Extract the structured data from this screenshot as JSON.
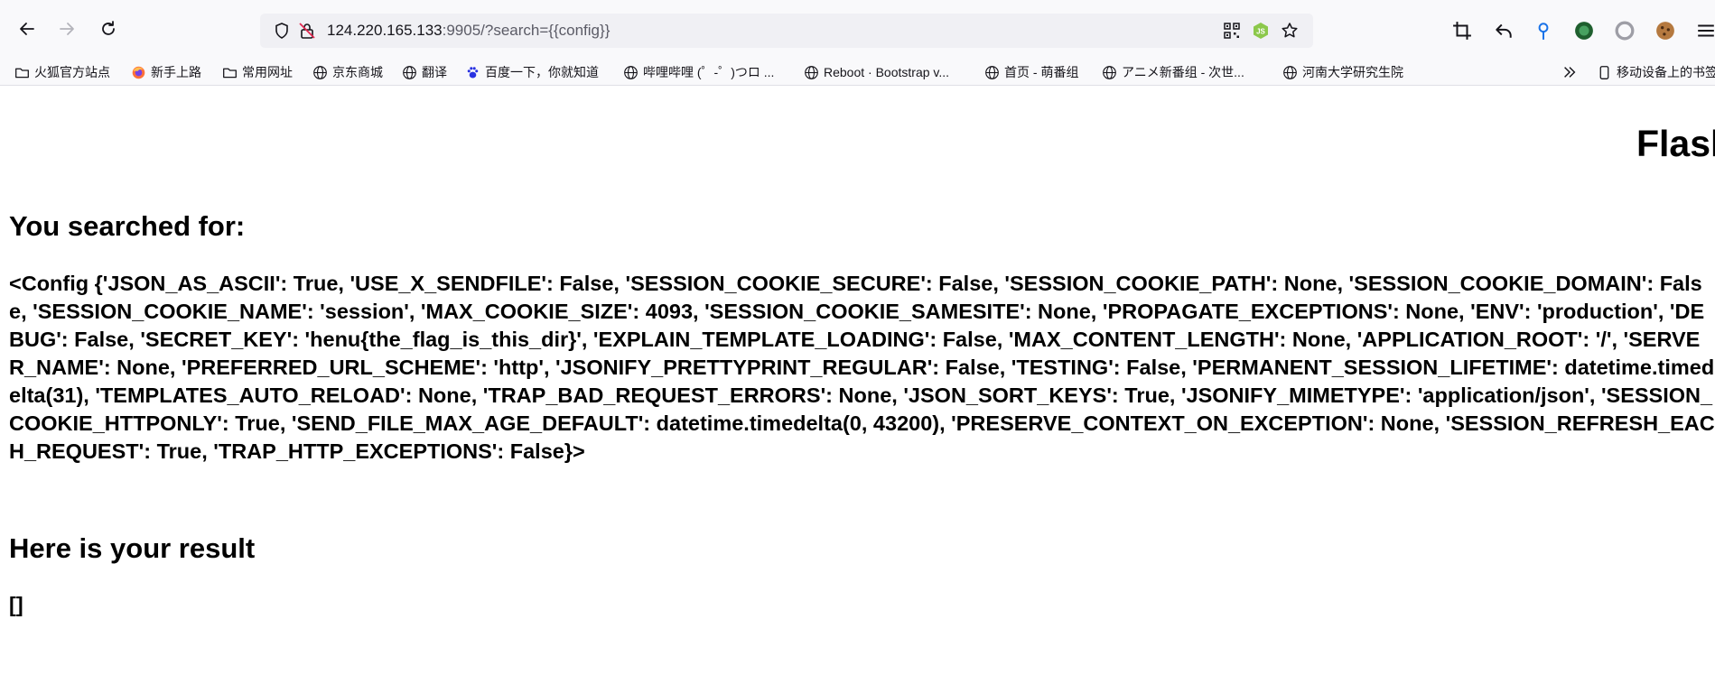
{
  "browser": {
    "url_host": "124.220.165.133",
    "url_rest": ":9905/?search={{config}}",
    "icons": {
      "back": "back-arrow-icon",
      "forward": "forward-arrow-icon",
      "reload": "reload-icon",
      "shield": "tracking-protection-shield-icon",
      "lock": "insecure-lock-icon",
      "qr": "qr-code-icon",
      "node": "nodejs-extension-icon",
      "star": "bookmark-star-icon",
      "screenshot": "crop-screenshot-icon",
      "undo": "undo-arrow-icon",
      "location": "location-pin-icon",
      "ext_green": "green-extension-icon",
      "ext_gray": "gray-circle-extension-icon",
      "cookie": "cookie-icon",
      "menu": "hamburger-menu-icon"
    }
  },
  "bookmarks": {
    "items": [
      {
        "label": "火狐官方站点",
        "icon": "folder-icon"
      },
      {
        "label": "新手上路",
        "icon": "firefox-icon"
      },
      {
        "label": "常用网址",
        "icon": "folder-icon"
      },
      {
        "label": "京东商城",
        "icon": "globe-icon"
      },
      {
        "label": "翻译",
        "icon": "globe-icon"
      },
      {
        "label": "百度一下，你就知道",
        "icon": "baidu-paw-icon"
      },
      {
        "label": "哔哩哔哩 (゜-゜)つロ ...",
        "icon": "globe-icon"
      },
      {
        "label": "Reboot · Bootstrap v...",
        "icon": "globe-icon"
      },
      {
        "label": "首页 - 萌番组",
        "icon": "globe-icon"
      },
      {
        "label": "アニメ新番组 - 次世...",
        "icon": "globe-icon"
      },
      {
        "label": "河南大学研究生院",
        "icon": "globe-icon"
      }
    ],
    "more_icon": "chevron-double-right-icon",
    "mobile_label": "移动设备上的书签",
    "mobile_icon": "mobile-device-icon"
  },
  "page": {
    "title": "Flask",
    "searched_heading": "You searched for:",
    "config_text": "<Config {'JSON_AS_ASCII': True, 'USE_X_SENDFILE': False, 'SESSION_COOKIE_SECURE': False, 'SESSION_COOKIE_PATH': None, 'SESSION_COOKIE_DOMAIN': False, 'SESSION_COOKIE_NAME': 'session', 'MAX_COOKIE_SIZE': 4093, 'SESSION_COOKIE_SAMESITE': None, 'PROPAGATE_EXCEPTIONS': None, 'ENV': 'production', 'DEBUG': False, 'SECRET_KEY': 'henu{the_flag_is_this_dir}', 'EXPLAIN_TEMPLATE_LOADING': False, 'MAX_CONTENT_LENGTH': None, 'APPLICATION_ROOT': '/', 'SERVER_NAME': None, 'PREFERRED_URL_SCHEME': 'http', 'JSONIFY_PRETTYPRINT_REGULAR': False, 'TESTING': False, 'PERMANENT_SESSION_LIFETIME': datetime.timedelta(31), 'TEMPLATES_AUTO_RELOAD': None, 'TRAP_BAD_REQUEST_ERRORS': None, 'JSON_SORT_KEYS': True, 'JSONIFY_MIMETYPE': 'application/json', 'SESSION_COOKIE_HTTPONLY': True, 'SEND_FILE_MAX_AGE_DEFAULT': datetime.timedelta(0, 43200), 'PRESERVE_CONTEXT_ON_EXCEPTION': None, 'SESSION_REFRESH_EACH_REQUEST': True, 'TRAP_HTTP_EXCEPTIONS': False}>",
    "result_heading": "Here is your result",
    "result_text": "[]"
  }
}
